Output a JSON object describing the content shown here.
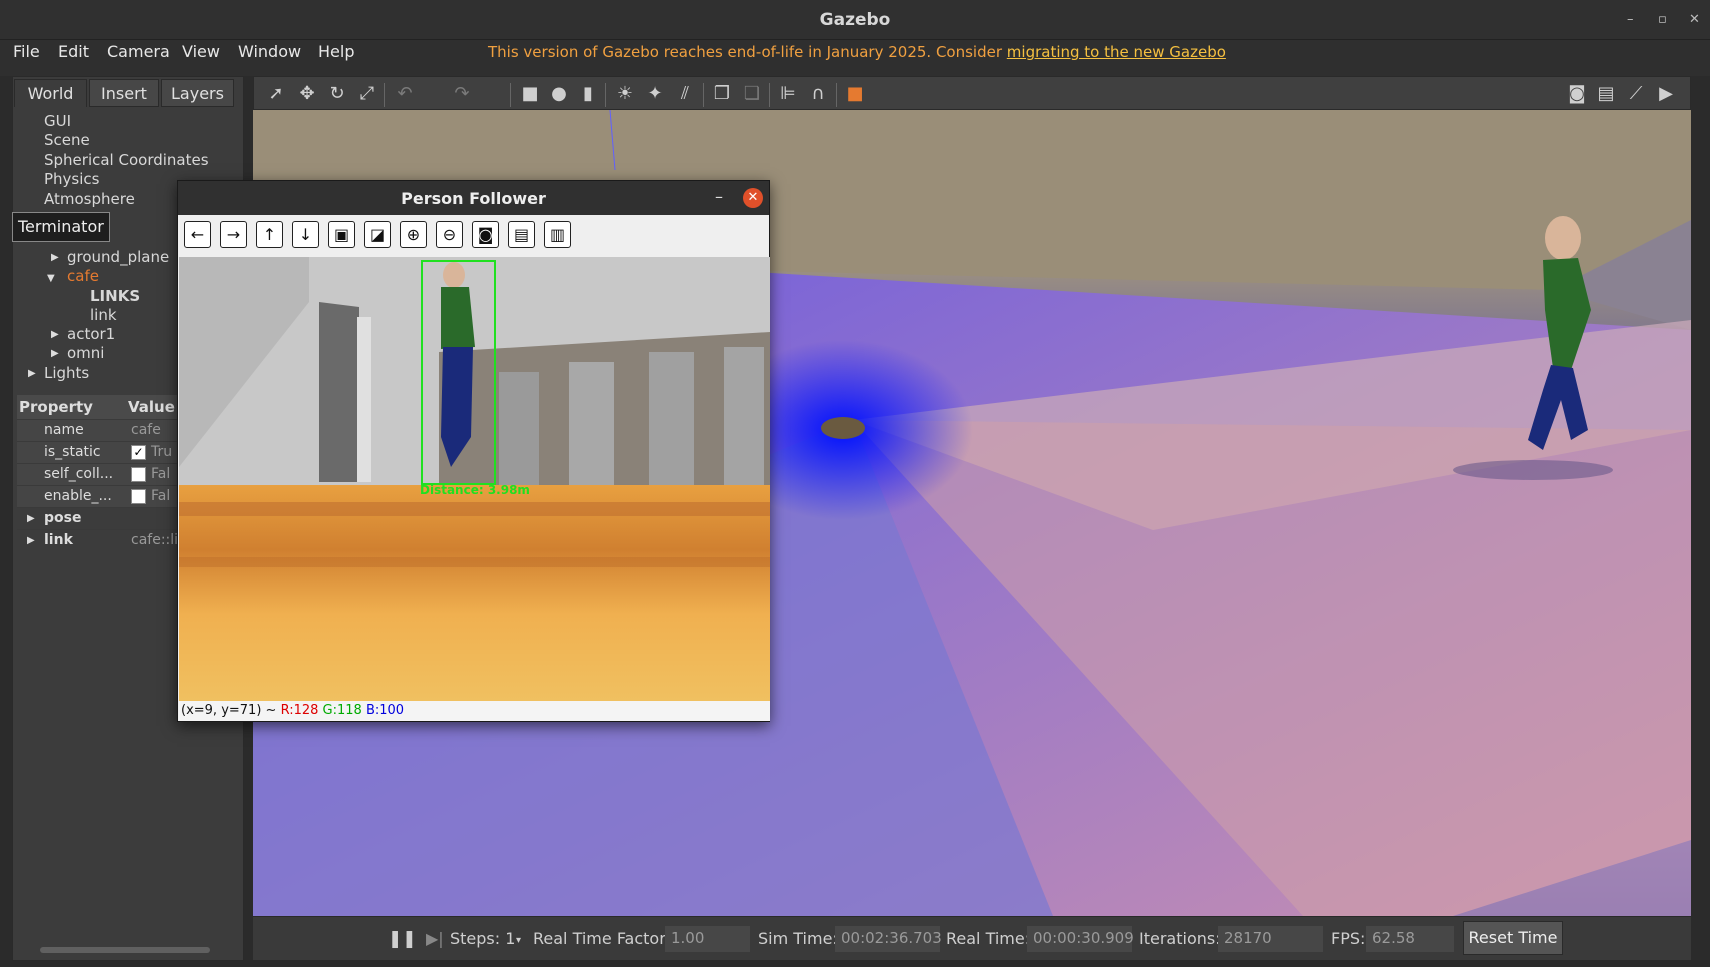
{
  "window": {
    "title": "Gazebo",
    "min": "–",
    "max": "▫",
    "close": "✕"
  },
  "menu": [
    "File",
    "Edit",
    "Camera",
    "View",
    "Window",
    "Help"
  ],
  "eol": {
    "text": "This version of Gazebo reaches end-of-life in January 2025. Consider ",
    "link": "migrating to the new Gazebo"
  },
  "left": {
    "tabs": [
      "World",
      "Insert",
      "Layers"
    ],
    "tree": {
      "gui": "GUI",
      "scene": "Scene",
      "spherical": "Spherical Coordinates",
      "physics": "Physics",
      "atmosphere": "Atmosphere",
      "ground_plane": "ground_plane",
      "cafe": "cafe",
      "links": "LINKS",
      "link": "link",
      "actor1": "actor1",
      "omni": "omni",
      "lights": "Lights"
    },
    "tooltip": "Terminator",
    "props": {
      "h_property": "Property",
      "h_value": "Value",
      "rows": [
        {
          "k": "name",
          "v": "cafe"
        },
        {
          "k": "is_static",
          "v": "Tru",
          "checked": true
        },
        {
          "k": "self_coll...",
          "v": "Fal",
          "checked": false
        },
        {
          "k": "enable_...",
          "v": "Fal",
          "checked": false
        },
        {
          "k": "pose",
          "v": ""
        },
        {
          "k": "link",
          "v": "cafe::li"
        }
      ]
    }
  },
  "toolbar": {
    "icons": [
      "select-icon",
      "translate-icon",
      "rotate-icon",
      "scale-icon",
      "undo-icon",
      "redo-icon",
      "box-icon",
      "sphere-icon",
      "cylinder-icon",
      "point-light-icon",
      "spot-light-icon",
      "directional-light-icon",
      "copy-icon",
      "paste-icon",
      "align-icon",
      "snap-icon",
      "color-icon",
      "screenshot-icon",
      "log-icon",
      "plot-icon",
      "video-icon"
    ]
  },
  "status": {
    "steps_label": "Steps: 1",
    "rtf_label": "Real Time Factor:",
    "rtf": "1.00",
    "sim_label": "Sim Time:",
    "sim": "00:02:36.703",
    "real_label": "Real Time:",
    "real": "00:00:30.909",
    "iter_label": "Iterations:",
    "iter": "28170",
    "fps_label": "FPS:",
    "fps": "62.58",
    "reset": "Reset Time"
  },
  "follower": {
    "title": "Person Follower",
    "distance": "Distance: 3.98m",
    "coord": "(x=9, y=71) ~ ",
    "r": "R:128",
    "g": "G:118",
    "b": "B:100"
  }
}
